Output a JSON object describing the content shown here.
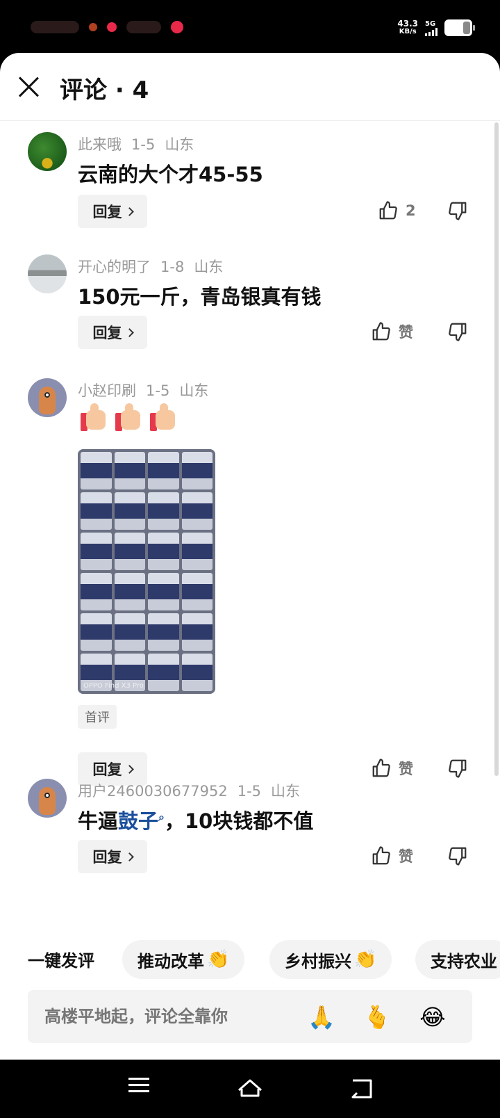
{
  "status_bar": {
    "network_speed_value": "43.3",
    "network_speed_unit": "KB/s",
    "signal_label": "5G"
  },
  "sheet": {
    "title": "评论 · 4"
  },
  "comments": [
    {
      "user": "此来哦",
      "date": "1-5",
      "region": "山东",
      "text": "云南的大个才45-55",
      "reply_label": "回复",
      "like_label": "2"
    },
    {
      "user": "开心的明了",
      "date": "1-8",
      "region": "山东",
      "text": "150元一斤，青岛银真有钱",
      "reply_label": "回复",
      "like_label": "赞"
    },
    {
      "user": "小赵印刷",
      "date": "1-5",
      "region": "山东",
      "emoji": [
        "thumbs-up",
        "thumbs-up",
        "thumbs-up"
      ],
      "photo_watermark": "OPPO Find X3 Pro",
      "first_tag": "首评",
      "reply_label": "回复",
      "like_label": "赞"
    },
    {
      "user": "用户2460030677952",
      "date": "1-5",
      "region": "山东",
      "text_prefix": "牛逼",
      "text_link": "鼓子",
      "text_suffix": "，10块钱都不值",
      "reply_label": "回复",
      "like_label": "赞"
    }
  ],
  "quick_reply": {
    "label": "一键发评",
    "chips": [
      "推动改革",
      "乡村振兴",
      "支持农业"
    ]
  },
  "input": {
    "placeholder": "高楼平地起，评论全靠你"
  },
  "colors": {
    "link": "#1a4f9c",
    "muted": "#999999"
  }
}
